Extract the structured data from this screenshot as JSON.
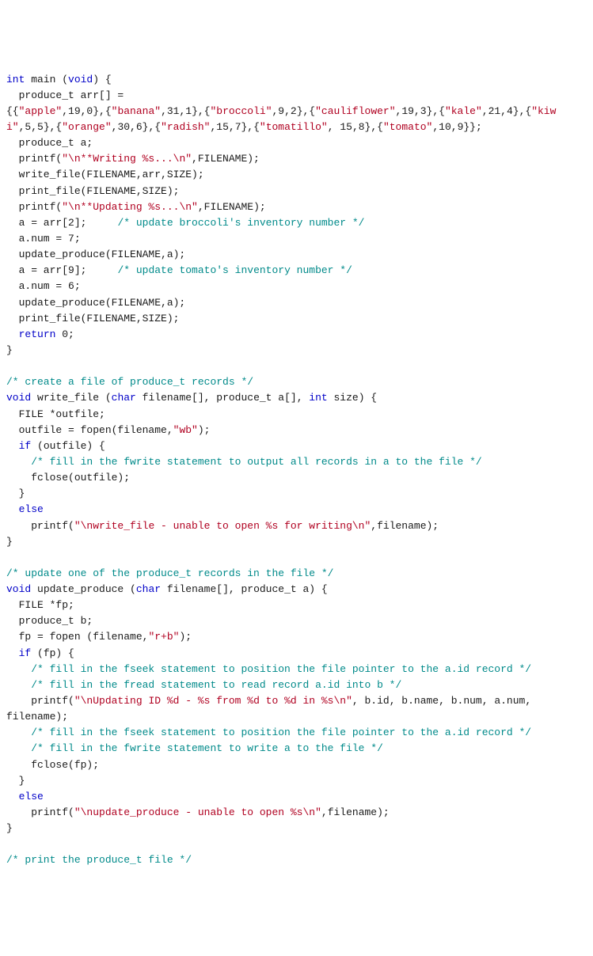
{
  "code": {
    "l01a": "int",
    "l01b": " main (",
    "l01c": "void",
    "l01d": ") {",
    "l02": "  produce_t arr[] =",
    "l03a": "{{",
    "l03b": "\"apple\"",
    "l03c": ",19,0},{",
    "l03d": "\"banana\"",
    "l03e": ",31,1},{",
    "l03f": "\"broccoli\"",
    "l03g": ",9,2},{",
    "l03h": "\"cauliflower\"",
    "l03i": ",19,3},{",
    "l03j": "\"kale\"",
    "l03k": ",21,4},{",
    "l03l": "\"kiw",
    "l04a": "i\"",
    "l04b": ",5,5},{",
    "l04c": "\"orange\"",
    "l04d": ",30,6},{",
    "l04e": "\"radish\"",
    "l04f": ",15,7},{",
    "l04g": "\"tomatillo\"",
    "l04h": ", 15,8},{",
    "l04i": "\"tomato\"",
    "l04j": ",10,9}};",
    "l05": "  produce_t a;",
    "l06a": "  printf(",
    "l06b": "\"\\n**Writing %s...\\n\"",
    "l06c": ",FILENAME);",
    "l07": "  write_file(FILENAME,arr,SIZE);",
    "l08": "  print_file(FILENAME,SIZE);",
    "l09a": "  printf(",
    "l09b": "\"\\n**Updating %s...\\n\"",
    "l09c": ",FILENAME);",
    "l10a": "  a = arr[2];     ",
    "l10b": "/* update broccoli's inventory number */",
    "l11": "  a.num = 7;",
    "l12": "  update_produce(FILENAME,a);",
    "l13a": "  a = arr[9];     ",
    "l13b": "/* update tomato's inventory number */",
    "l14": "  a.num = 6;",
    "l15": "  update_produce(FILENAME,a);",
    "l16": "  print_file(FILENAME,SIZE);",
    "l17a": "  ",
    "l17b": "return",
    "l17c": " 0;",
    "l18": "}",
    "l19": "",
    "l20": "/* create a file of produce_t records */",
    "l21a": "void",
    "l21b": " write_file (",
    "l21c": "char",
    "l21d": " filename[], produce_t a[], ",
    "l21e": "int",
    "l21f": " size) {",
    "l22": "  FILE *outfile;",
    "l23a": "  outfile = fopen(filename,",
    "l23b": "\"wb\"",
    "l23c": ");",
    "l24a": "  ",
    "l24b": "if",
    "l24c": " (outfile) {",
    "l25": "    /* fill in the fwrite statement to output all records in a to the file */",
    "l26": "    fclose(outfile);",
    "l27": "  }",
    "l28a": "  ",
    "l28b": "else",
    "l29a": "    printf(",
    "l29b": "\"\\nwrite_file - unable to open %s for writing\\n\"",
    "l29c": ",filename);",
    "l30": "}",
    "l31": "",
    "l32": "/* update one of the produce_t records in the file */",
    "l33a": "void",
    "l33b": " update_produce (",
    "l33c": "char",
    "l33d": " filename[], produce_t a) {",
    "l34": "  FILE *fp;",
    "l35": "  produce_t b;",
    "l36a": "  fp = fopen (filename,",
    "l36b": "\"r+b\"",
    "l36c": ");",
    "l37a": "  ",
    "l37b": "if",
    "l37c": " (fp) {",
    "l38": "    /* fill in the fseek statement to position the file pointer to the a.id record */",
    "l39": "    /* fill in the fread statement to read record a.id into b */",
    "l40a": "    printf(",
    "l40b": "\"\\nUpdating ID %d - %s from %d to %d in %s\\n\"",
    "l40c": ", b.id, b.name, b.num, a.num,",
    "l41": "filename);",
    "l42": "    /* fill in the fseek statement to position the file pointer to the a.id record */",
    "l43": "    /* fill in the fwrite statement to write a to the file */",
    "l44": "    fclose(fp);",
    "l45": "  }",
    "l46a": "  ",
    "l46b": "else",
    "l47a": "    printf(",
    "l47b": "\"\\nupdate_produce - unable to open %s\\n\"",
    "l47c": ",filename);",
    "l48": "}",
    "l49": "",
    "l50": "/* print the produce_t file */"
  }
}
